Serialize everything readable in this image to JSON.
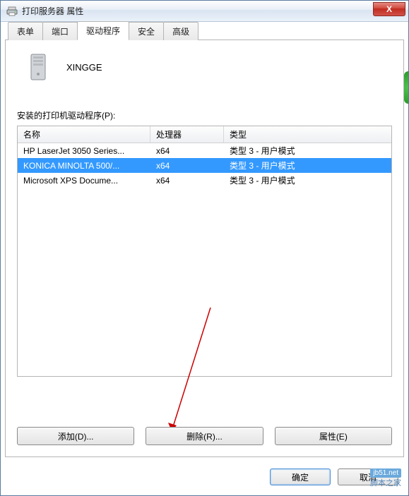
{
  "window": {
    "title": "打印服务器 属性",
    "close": "X"
  },
  "tabs": {
    "forms": "表单",
    "ports": "端口",
    "drivers": "驱动程序",
    "security": "安全",
    "advanced": "高级"
  },
  "server": {
    "name": "XINGGE"
  },
  "drivers_section": {
    "label": "安装的打印机驱动程序(P):",
    "columns": {
      "name": "名称",
      "processor": "处理器",
      "type": "类型"
    },
    "rows": [
      {
        "name": "HP LaserJet 3050 Series...",
        "proc": "x64",
        "type": "类型 3 - 用户模式",
        "selected": false
      },
      {
        "name": "KONICA MINOLTA 500/...",
        "proc": "x64",
        "type": "类型 3 - 用户模式",
        "selected": true
      },
      {
        "name": "Microsoft XPS Docume...",
        "proc": "x64",
        "type": "类型 3 - 用户模式",
        "selected": false
      }
    ]
  },
  "buttons": {
    "add": "添加(D)...",
    "remove": "删除(R)...",
    "properties": "属性(E)"
  },
  "dialog": {
    "ok": "确定",
    "cancel": "取消"
  },
  "watermark": {
    "url": "jb51.net",
    "text": "脚本之家"
  }
}
